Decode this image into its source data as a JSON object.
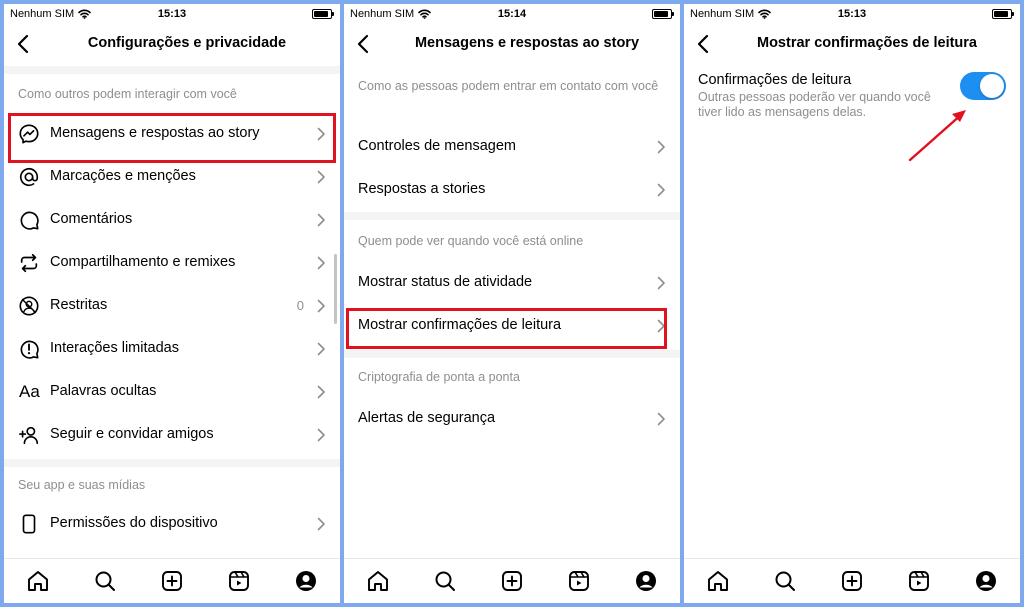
{
  "status": {
    "carrier": "Nenhum SIM",
    "times": [
      "15:13",
      "15:14",
      "15:13"
    ]
  },
  "panel1": {
    "title": "Configurações e privacidade",
    "section1": "Como outros podem interagir com você",
    "items": [
      {
        "label": "Mensagens e respostas ao story",
        "icon": "messenger-icon"
      },
      {
        "label": "Marcações e menções",
        "icon": "at-sign-icon"
      },
      {
        "label": "Comentários",
        "icon": "comment-icon"
      },
      {
        "label": "Compartilhamento e remixes",
        "icon": "share-remix-icon"
      },
      {
        "label": "Restritas",
        "icon": "restricted-icon",
        "count": "0"
      },
      {
        "label": "Interações limitadas",
        "icon": "limited-interactions-icon"
      },
      {
        "label": "Palavras ocultas",
        "icon": "hidden-words-icon",
        "glyph": "Aa"
      },
      {
        "label": "Seguir e convidar amigos",
        "icon": "add-person-icon"
      }
    ],
    "section2": "Seu app e suas mídias",
    "items2": [
      {
        "label": "Permissões do dispositivo",
        "icon": "device-icon"
      }
    ]
  },
  "panel2": {
    "title": "Mensagens e respostas ao story",
    "section1": "Como as pessoas podem entrar em contato com você",
    "items1": [
      "Controles de mensagem",
      "Respostas a stories"
    ],
    "section2": "Quem pode ver quando você está online",
    "items2": [
      "Mostrar status de atividade",
      "Mostrar confirmações de leitura"
    ],
    "section3": "Criptografia de ponta a ponta",
    "items3": [
      "Alertas de segurança"
    ]
  },
  "panel3": {
    "title": "Mostrar confirmações de leitura",
    "setting_title": "Confirmações de leitura",
    "setting_desc": "Outras pessoas poderão ver quando você tiver lido as mensagens delas.",
    "toggle_on": true
  },
  "colors": {
    "highlight": "#e1121f",
    "toggle": "#1c8ff0",
    "frame": "#7fa9ee"
  },
  "tabbar_icons": [
    "home-icon",
    "search-icon",
    "create-icon",
    "reels-icon",
    "profile-icon"
  ]
}
